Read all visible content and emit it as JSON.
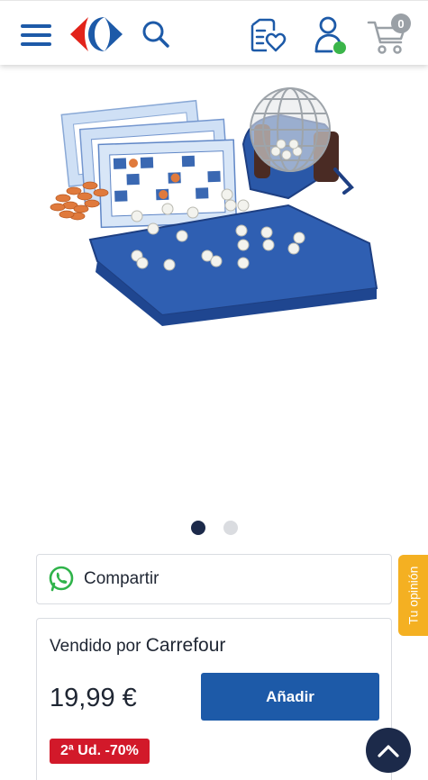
{
  "header": {
    "menu_icon": "hamburger-menu-icon",
    "logo_name": "carrefour-logo",
    "search_icon": "search-icon",
    "wishlist_icon": "wishlist-heart-icon",
    "account_icon": "user-account-icon",
    "cart_icon": "shopping-cart-icon",
    "cart_count": "0",
    "brand_colors": {
      "blue": "#1d5aa8",
      "red": "#e2231a",
      "navy": "#1c2a4a",
      "account_dot": "#3bb54a"
    }
  },
  "gallery": {
    "image_subject": "bingo-set-product-image",
    "total_images": 2,
    "active_index": 0
  },
  "share": {
    "icon": "whatsapp-icon",
    "label": "Compartir"
  },
  "opinion_tab": {
    "label": "Tu opinión",
    "color": "#f4b022"
  },
  "seller": {
    "prefix": "Vendido por",
    "name": "Carrefour"
  },
  "purchase": {
    "price": "19,99 €",
    "add_button": "Añadir",
    "promo": "2ª Ud. -70%",
    "promo_color": "#d2192a"
  },
  "scroll_top": {
    "icon": "chevron-up-icon"
  }
}
